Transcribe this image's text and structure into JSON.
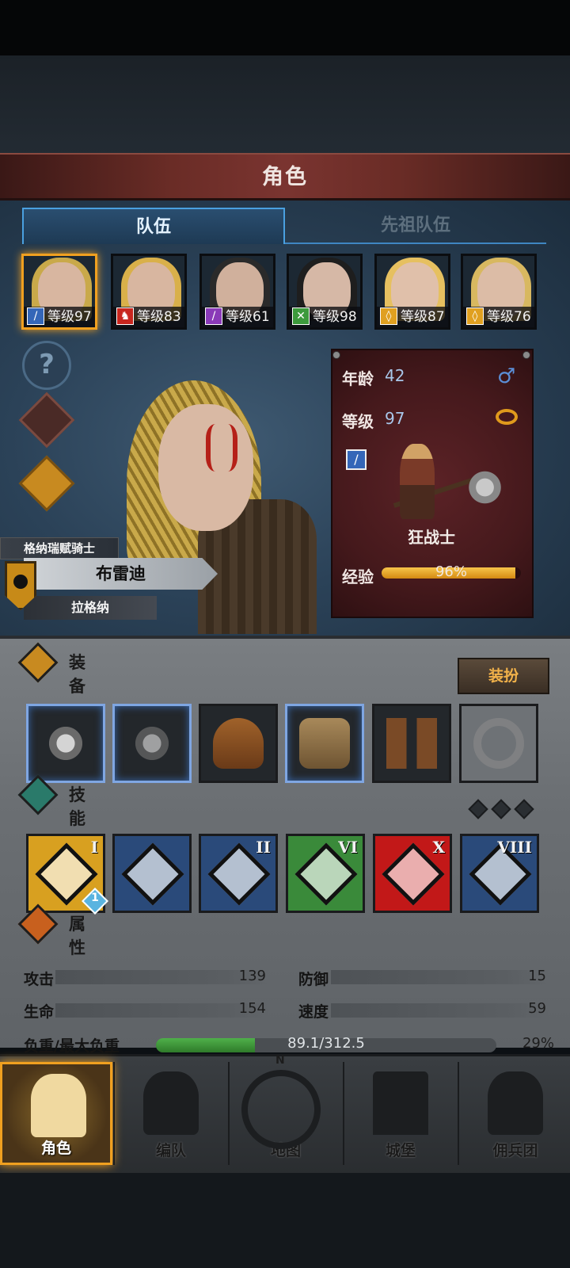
{
  "header": {
    "title": "角色"
  },
  "tabs": {
    "team": "队伍",
    "ancestor": "先祖队伍"
  },
  "roster": [
    {
      "level": "等级97",
      "class_color": "#3466b8",
      "hair": "#c9a94a",
      "selected": true
    },
    {
      "level": "等级83",
      "class_color": "#c8261e",
      "hair": "#d9b04a",
      "selected": false
    },
    {
      "level": "等级61",
      "class_color": "#8a3ab8",
      "hair": "#2a2a2a",
      "selected": false
    },
    {
      "level": "等级98",
      "class_color": "#3c9a3c",
      "hair": "#1e1e1e",
      "selected": false
    },
    {
      "level": "等级87",
      "class_color": "#e0a020",
      "hair": "#e6c060",
      "selected": false
    },
    {
      "level": "等级76",
      "class_color": "#e0a020",
      "hair": "#d8b860",
      "selected": false
    }
  ],
  "character": {
    "subtitle": "格纳瑞赋骑士",
    "name": "布雷迪",
    "origin": "拉格纳",
    "age_label": "年龄",
    "age": "42",
    "level_label": "等级",
    "level": "97",
    "class_name": "狂战士",
    "xp_label": "经验",
    "xp_text": "96%",
    "xp_fraction": 0.96
  },
  "equipment": {
    "title": "装备",
    "outfit_button": "装扮",
    "slots": [
      "axe-main",
      "axe-off",
      "helmet",
      "chest-armor",
      "boots",
      "ring-empty"
    ]
  },
  "skills": {
    "title": "技能",
    "items": [
      {
        "icon": "sword-burst",
        "numeral": "I",
        "color": "#d8a020"
      },
      {
        "icon": "twin-peaks",
        "numeral": "",
        "color": "#2a4a7a"
      },
      {
        "icon": "crossed-swords",
        "numeral": "II",
        "color": "#2a4a7a"
      },
      {
        "icon": "claw",
        "numeral": "VI",
        "color": "#3a8a3a"
      },
      {
        "icon": "sword-strike",
        "numeral": "X",
        "color": "#c21818"
      },
      {
        "icon": "shield-burst",
        "numeral": "VIII",
        "color": "#2a4a7a"
      }
    ],
    "badge": "1"
  },
  "attributes": {
    "title": "属性",
    "attack_label": "攻击",
    "attack": "139",
    "defense_label": "防御",
    "defense": "15",
    "hp_label": "生命",
    "hp": "154",
    "speed_label": "速度",
    "speed": "59",
    "load_label": "负重/最大负重",
    "load_text": "89.1/312.5",
    "load_percent": "29%",
    "load_fraction": 0.29
  },
  "nav": {
    "character": "角色",
    "formation": "编队",
    "map": "地图",
    "map_north": "N",
    "castle": "城堡",
    "mercenary": "佣兵团"
  }
}
